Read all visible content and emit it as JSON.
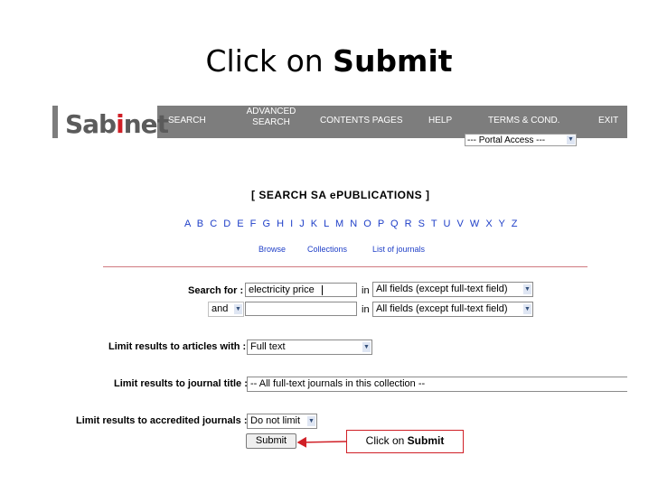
{
  "slide": {
    "title_prefix": "Click on ",
    "title_bold": "Submit"
  },
  "nav": {
    "logo_left": "Sab",
    "logo_red": "i",
    "logo_right": "net",
    "items": [
      {
        "label": "SEARCH"
      },
      {
        "label": "ADVANCED\nSEARCH"
      },
      {
        "label": "CONTENTS PAGES"
      },
      {
        "label": "HELP"
      },
      {
        "label": "TERMS & COND."
      },
      {
        "label": "EXIT"
      }
    ],
    "portal_access": "--- Portal Access ---"
  },
  "search": {
    "heading": "[ SEARCH SA ePUBLICATIONS ]",
    "letters": [
      "A",
      "B",
      "C",
      "D",
      "E",
      "F",
      "G",
      "H",
      "I",
      "J",
      "K",
      "L",
      "M",
      "N",
      "O",
      "P",
      "Q",
      "R",
      "S",
      "T",
      "U",
      "V",
      "W",
      "X",
      "Y",
      "Z"
    ],
    "sublinks": [
      "Browse",
      "Collections",
      "List of journals"
    ],
    "search_for_label": "Search for :",
    "search_for_value": "electricity price",
    "in_label": "in",
    "field1": "All fields (except full-text field)",
    "bool_op": "and",
    "field2_value": "",
    "field2": "All fields (except full-text field)",
    "limit_articles_label": "Limit results to articles with :",
    "limit_articles_value": "Full text",
    "limit_journal_label": "Limit results to journal title :",
    "limit_journal_value": "-- All full-text journals in this collection --",
    "limit_accredited_label": "Limit results to accredited journals :",
    "limit_accredited_value": "Do not limit",
    "submit_label": "Submit"
  },
  "callout": {
    "prefix": "Click on ",
    "bold": "Submit",
    "color": "#d01f26"
  }
}
